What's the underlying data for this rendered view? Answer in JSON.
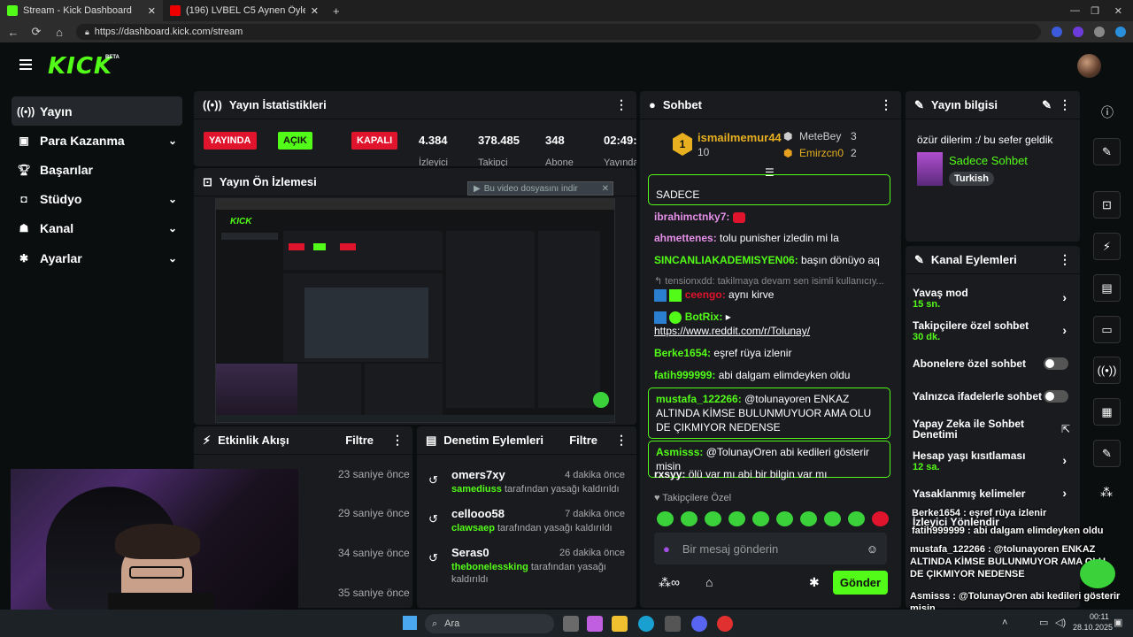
{
  "browser": {
    "tabs": [
      {
        "title": "Stream - Kick Dashboard"
      },
      {
        "title": "(196) LVBEL C5 Aynen Öyle S..."
      }
    ],
    "url": "https://dashboard.kick.com/stream"
  },
  "header": {
    "logo": "KICK",
    "beta": "BETA"
  },
  "sidebar": {
    "items": [
      {
        "label": "Yayın",
        "icon": "broadcast-icon"
      },
      {
        "label": "Para Kazanma",
        "icon": "dollar-icon"
      },
      {
        "label": "Başarılar",
        "icon": "trophy-icon"
      },
      {
        "label": "Stüdyo",
        "icon": "studio-icon"
      },
      {
        "label": "Kanal",
        "icon": "user-icon"
      },
      {
        "label": "Ayarlar",
        "icon": "gear-icon"
      }
    ]
  },
  "stats": {
    "title": "Yayın İstatistikleri",
    "live": "YAYINDA",
    "open": "AÇIK",
    "closed": "KAPALI",
    "row_labels": [
      "Ya...",
      "Pasta...",
      "Sohb..."
    ],
    "viewers": "4.384",
    "viewers_label": "İzleyici",
    "followers": "378.485",
    "followers_label": "Takipçi",
    "subs": "348",
    "subs_label": "Abone",
    "uptime": "02:49:",
    "uptime_label": "Yayında"
  },
  "preview": {
    "title": "Yayın Ön İzlemesi",
    "download": "Bu video dosyasını indir"
  },
  "activity": {
    "title": "Etkinlik Akışı",
    "filter": "Filtre",
    "times": [
      "23 saniye önce",
      "29 saniye önce",
      "34 saniye önce",
      "35 saniye önce"
    ]
  },
  "moderation": {
    "title": "Denetim Eylemleri",
    "filter": "Filtre",
    "rows": [
      {
        "name": "omers7xy",
        "time": "4 dakika önce",
        "by": "samediuss",
        "text": "tarafından yasağı kaldırıldı"
      },
      {
        "name": "cellooo58",
        "time": "7 dakika önce",
        "by": "clawsaep",
        "text": "tarafından yasağı kaldırıldı"
      },
      {
        "name": "Seras0",
        "time": "26 dakika önce",
        "by": "thebonelessking",
        "text": "tarafından yasağı kaldırıldı"
      }
    ]
  },
  "chat": {
    "title": "Sohbet",
    "top": [
      {
        "rank": "1",
        "name": "ismailmemur44",
        "count": "10"
      },
      {
        "name": "MeteBey",
        "count": "3"
      },
      {
        "name": "Emirzcn0",
        "count": "2"
      }
    ],
    "msgs": {
      "m0": "SADECE",
      "m1u": "ibrahimctnky7:",
      "m2u": "ahmettenes:",
      "m2": "tolu punisher izledin mi la",
      "m3u": "SINCANLIAKADEMISYEN06:",
      "m3": "başın dönüyo aq",
      "m4": "tensionxdd: takilmaya devam sen isimli kullanıcıy...",
      "m5u": "ceengo:",
      "m5": "aynı kirve",
      "m6u": "BotRix:",
      "m6": "▸",
      "m6l": "https://www.reddit.com/r/Tolunay/",
      "m7u": "Berke1654:",
      "m7": "eşref rüya izlenir",
      "m8u": "fatih999999:",
      "m8": "abi dalgam elimdeyken oldu",
      "m9u": "mustafa_122266:",
      "m9": "@tolunayoren ENKAZ ALTINDA KİMSE BULUNMUYUOR AMA OLU DE ÇIKMIYOR NEDENSE",
      "m10u": "Asmisss:",
      "m10": "@TolunayOren abi kedileri gösterir misin",
      "m11u": "rxsyy:",
      "m11": "ölü var mı abi bir bilgin var mı"
    },
    "mode": "Takipçilere Özel",
    "placeholder": "Bir mesaj gönderin",
    "send": "Gönder"
  },
  "info": {
    "title": "Yayın bilgisi",
    "stream_title": "özür dilerim :/ bu sefer geldik",
    "category": "Sadece Sohbet",
    "tag": "Turkish"
  },
  "actions": {
    "title": "Kanal Eylemleri",
    "slow": "Yavaş mod",
    "slow_val": "15 sn.",
    "follow": "Takipçilere özel sohbet",
    "follow_val": "30 dk.",
    "subs": "Abonelere özel sohbet",
    "emote": "Yalnızca ifadelerle sohbet",
    "ai": "Yapay Zeka ile Sohbet Denetimi",
    "age": "Hesap yaşı kısıtlaması",
    "age_val": "12 sa.",
    "banned": "Yasaklanmış kelimeler",
    "viewer_dir": "İzleyici Yönlendir"
  },
  "overlay": {
    "l1": "Berke1654 : eşref rüya izlenir",
    "l2": "fatih999999 : abi dalgam elimdeyken oldu",
    "l3": "mustafa_122266 : @tolunayoren ENKAZ ALTINDA KİMSE BULUNMUYOR AMA OLU DE ÇIKMIYOR NEDENSE",
    "l4": "Asmisss : @TolunayOren abi kedileri gösterir misin"
  },
  "taskbar": {
    "search": "Ara",
    "time": "00:11",
    "date": "28.10.2025"
  },
  "colors": {
    "kick_green": "#53fc18",
    "live_red": "#e0142c",
    "panel": "#191b1f",
    "bg": "#0b0e0f"
  }
}
